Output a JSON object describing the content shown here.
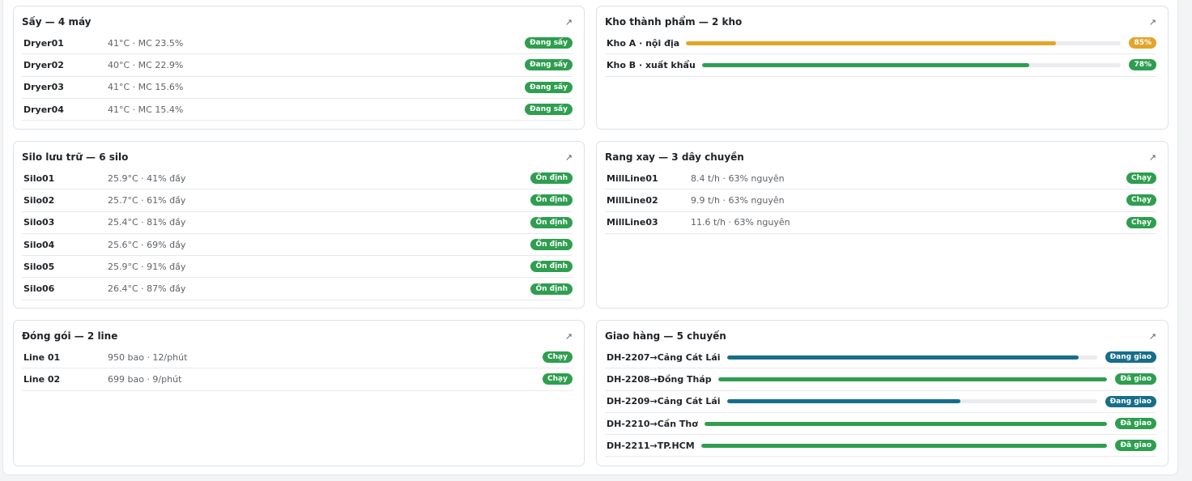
{
  "expand_icon": "↗",
  "dryers": {
    "title": "Sấy — 4 máy",
    "items": [
      {
        "name": "Dryer01",
        "info": "41°C · MC 23.5%",
        "status": "Đang sấy"
      },
      {
        "name": "Dryer02",
        "info": "40°C · MC 22.9%",
        "status": "Đang sấy"
      },
      {
        "name": "Dryer03",
        "info": "41°C · MC 15.6%",
        "status": "Đang sấy"
      },
      {
        "name": "Dryer04",
        "info": "41°C · MC 15.4%",
        "status": "Đang sấy"
      }
    ]
  },
  "warehouses": {
    "title": "Kho thành phẩm — 2 kho",
    "items": [
      {
        "name": "Kho A · nội địa",
        "fill": 0.85,
        "label": "85%",
        "color": "#e2a52a"
      },
      {
        "name": "Kho B · xuất khẩu",
        "fill": 0.78,
        "label": "78%",
        "color": "#2e9e4f"
      }
    ]
  },
  "silos": {
    "title": "Silo lưu trữ — 6 silo",
    "items": [
      {
        "name": "Silo01",
        "info": "25.9°C · 41% đầy",
        "status": "Ổn định"
      },
      {
        "name": "Silo02",
        "info": "25.7°C · 61% đầy",
        "status": "Ổn định"
      },
      {
        "name": "Silo03",
        "info": "25.4°C · 81% đầy",
        "status": "Ổn định"
      },
      {
        "name": "Silo04",
        "info": "25.6°C · 69% đầy",
        "status": "Ổn định"
      },
      {
        "name": "Silo05",
        "info": "25.9°C · 91% đầy",
        "status": "Ổn định"
      },
      {
        "name": "Silo06",
        "info": "26.4°C · 87% đầy",
        "status": "Ổn định"
      }
    ]
  },
  "milling": {
    "title": "Rang xay — 3 dây chuyền",
    "items": [
      {
        "name": "MillLine01",
        "info": "8.4 t/h · 63% nguyên",
        "status": "Chạy"
      },
      {
        "name": "MillLine02",
        "info": "9.9 t/h · 63% nguyên",
        "status": "Chạy"
      },
      {
        "name": "MillLine03",
        "info": "11.6 t/h · 63% nguyên",
        "status": "Chạy"
      }
    ]
  },
  "packing": {
    "title": "Đóng gói — 2 line",
    "items": [
      {
        "name": "Line 01",
        "info": "950 bao · 12/phút",
        "status": "Chạy"
      },
      {
        "name": "Line 02",
        "info": "699 bao · 9/phút",
        "status": "Chạy"
      }
    ]
  },
  "delivery": {
    "title": "Giao hàng — 5 chuyến",
    "items": [
      {
        "name": "DH-2207→Cảng Cát Lái",
        "fill": 0.95,
        "status": "Đang giao",
        "color": "#176e8a"
      },
      {
        "name": "DH-2208→Đồng Tháp",
        "fill": 1.0,
        "status": "Đã giao",
        "color": "#2e9e4f"
      },
      {
        "name": "DH-2209→Cảng Cát Lái",
        "fill": 0.63,
        "status": "Đang giao",
        "color": "#176e8a"
      },
      {
        "name": "DH-2210→Cần Thơ",
        "fill": 1.0,
        "status": "Đã giao",
        "color": "#2e9e4f"
      },
      {
        "name": "DH-2211→TP.HCM",
        "fill": 1.0,
        "status": "Đã giao",
        "color": "#2e9e4f"
      }
    ]
  }
}
